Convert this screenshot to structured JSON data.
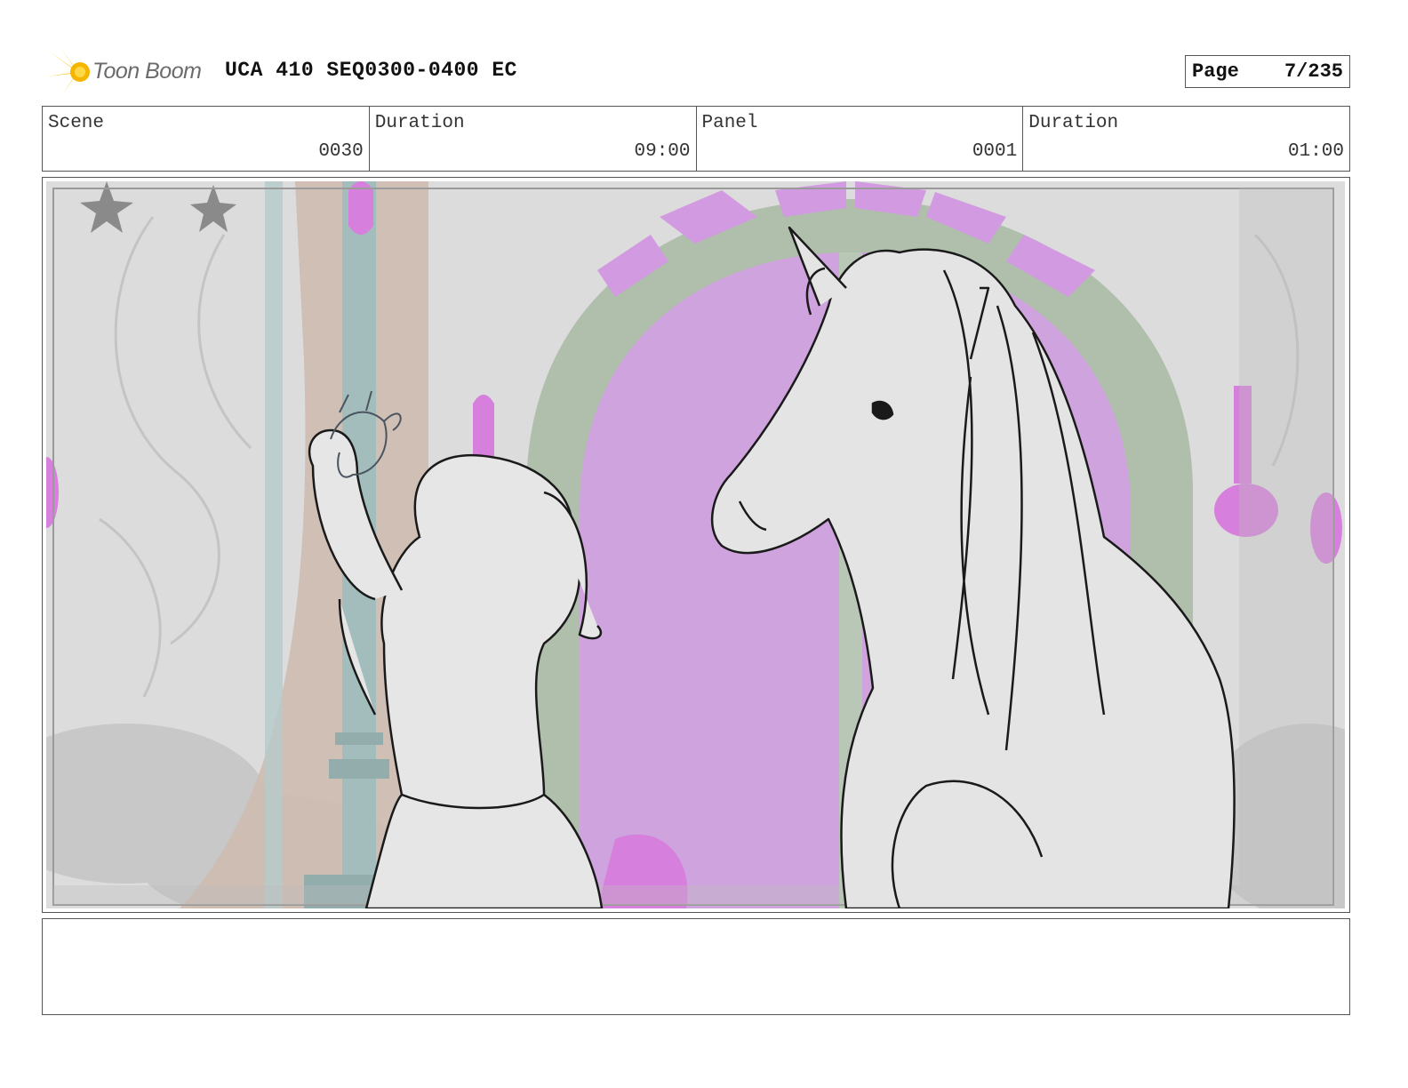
{
  "header": {
    "logo_text": "Toon Boom",
    "title": "UCA 410 SEQ0300-0400 EC",
    "page_label": "Page",
    "page_value": "7/235"
  },
  "info": [
    {
      "label": "Scene",
      "value": "0030"
    },
    {
      "label": "Duration",
      "value": "09:00"
    },
    {
      "label": "Panel",
      "value": "0001"
    },
    {
      "label": "Duration",
      "value": "01:00"
    }
  ],
  "notes": {
    "text": ""
  },
  "colors": {
    "wall": "#d9d9d9",
    "arch": "#a9b9a6",
    "window": "#cf9fdc",
    "accent_pink": "#d77fdc",
    "sketch": "#1a1a1a",
    "logo_yellow": "#f5c518"
  }
}
